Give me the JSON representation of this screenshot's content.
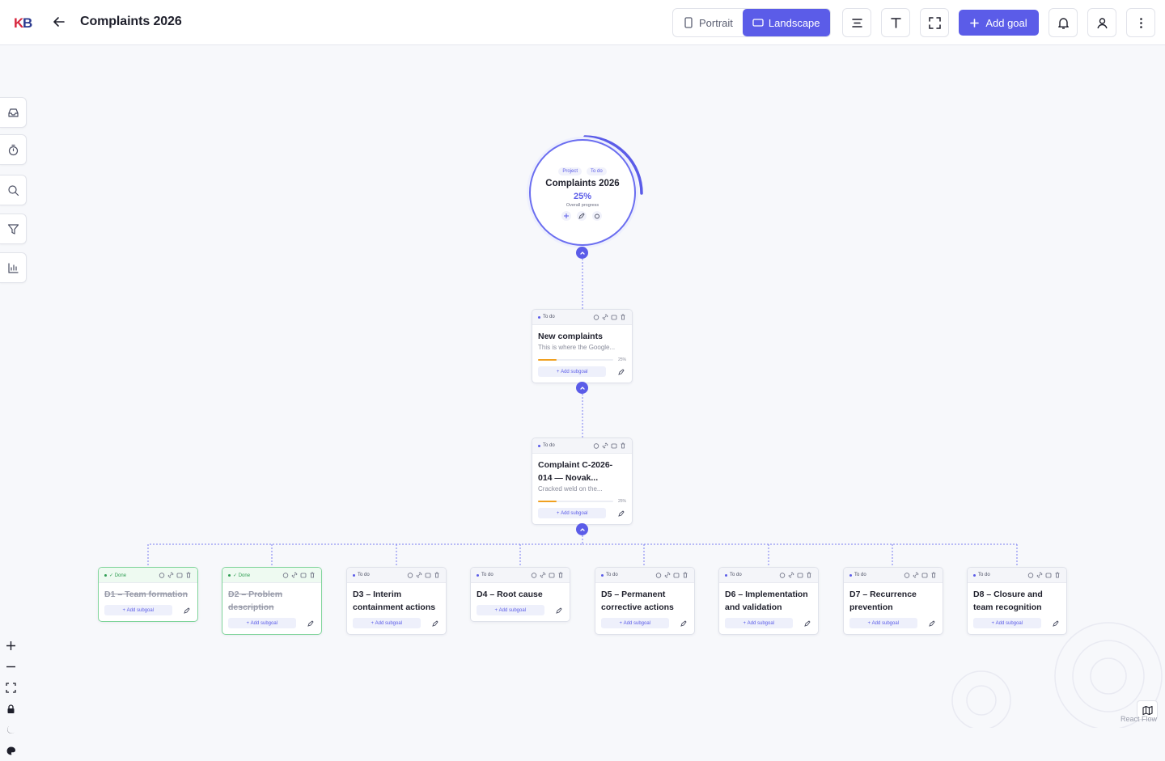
{
  "header": {
    "logo_text": "KB",
    "title": "Complaints 2026",
    "portrait_label": "Portrait",
    "landscape_label": "Landscape",
    "add_goal_label": "Add goal"
  },
  "project": {
    "type_badge": "Project",
    "status": "To do",
    "title": "Complaints 2026",
    "progress": "25%",
    "progress_caption": "Overall progress",
    "progress_value": 0.25
  },
  "cards": {
    "new_complaints": {
      "status": "To do",
      "title": "New complaints",
      "desc": "This is where the Google...",
      "pct": "25%",
      "add": "Add subgoal"
    },
    "complaint": {
      "status": "To do",
      "title": "Complaint C-2026-014 — Novak...",
      "desc": "Cracked weld on the...",
      "pct": "25%",
      "add": "Add subgoal"
    },
    "d1": {
      "status": "✓ Done",
      "title": "D1 – Team formation",
      "add": "Add subgoal"
    },
    "d2": {
      "status": "✓ Done",
      "title": "D2 – Problem description",
      "add": "Add subgoal"
    },
    "d3": {
      "status": "To do",
      "title": "D3 – Interim containment actions",
      "add": "Add subgoal"
    },
    "d4": {
      "status": "To do",
      "title": "D4 – Root cause",
      "add": "Add subgoal"
    },
    "d5": {
      "status": "To do",
      "title": "D5 – Permanent corrective actions",
      "add": "Add subgoal"
    },
    "d6": {
      "status": "To do",
      "title": "D6 – Implementation and validation",
      "add": "Add subgoal"
    },
    "d7": {
      "status": "To do",
      "title": "D7 – Recurrence prevention",
      "add": "Add subgoal"
    },
    "d8": {
      "status": "To do",
      "title": "D8 – Closure and team recognition",
      "add": "Add subgoal"
    }
  },
  "footer": {
    "attribution": "React Flow"
  },
  "colors": {
    "accent": "#5b5ce8",
    "done": "#2e9d52",
    "progress": "#f0a020"
  }
}
